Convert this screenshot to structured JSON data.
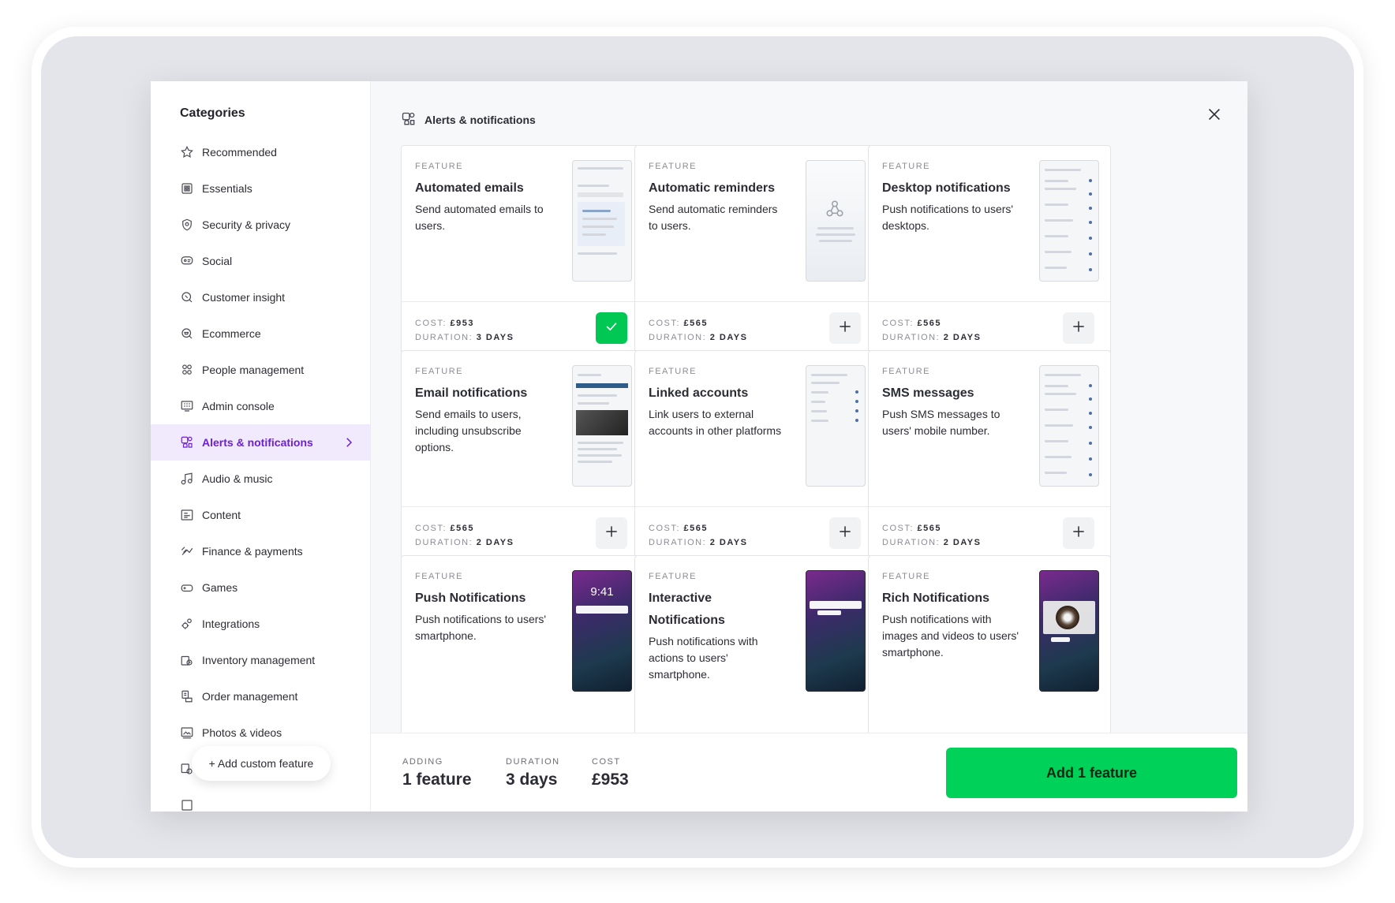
{
  "sidebar": {
    "title": "Categories",
    "items": [
      {
        "label": "Recommended",
        "icon": "star-icon"
      },
      {
        "label": "Essentials",
        "icon": "grid-icon"
      },
      {
        "label": "Security & privacy",
        "icon": "shield-icon"
      },
      {
        "label": "Social",
        "icon": "chat-icon"
      },
      {
        "label": "Customer insight",
        "icon": "insight-icon"
      },
      {
        "label": "Ecommerce",
        "icon": "cart-icon"
      },
      {
        "label": "People management",
        "icon": "people-icon"
      },
      {
        "label": "Admin console",
        "icon": "console-icon"
      },
      {
        "label": "Alerts & notifications",
        "icon": "bell-icon",
        "active": true
      },
      {
        "label": "Audio & music",
        "icon": "music-icon"
      },
      {
        "label": "Content",
        "icon": "content-icon"
      },
      {
        "label": "Finance & payments",
        "icon": "finance-icon"
      },
      {
        "label": "Games",
        "icon": "gamepad-icon"
      },
      {
        "label": "Integrations",
        "icon": "gear-icon"
      },
      {
        "label": "Inventory management",
        "icon": "inventory-icon"
      },
      {
        "label": "Order management",
        "icon": "order-icon"
      },
      {
        "label": "Photos & videos",
        "icon": "photo-icon"
      }
    ],
    "add_custom_label": "+ Add custom feature"
  },
  "header": {
    "breadcrumb": "Alerts & notifications",
    "breadcrumb_icon": "bell-icon",
    "close_icon": "close-icon"
  },
  "cards": [
    {
      "label": "FEATURE",
      "name": "Automated emails",
      "desc": "Send automated emails to users.",
      "cost_label": "COST:",
      "cost": "£953",
      "duration_label": "DURATION:",
      "duration": "3 DAYS",
      "added": true
    },
    {
      "label": "FEATURE",
      "name": "Automatic reminders",
      "desc": "Send automatic reminders to users.",
      "cost_label": "COST:",
      "cost": "£565",
      "duration_label": "DURATION:",
      "duration": "2 DAYS",
      "added": false
    },
    {
      "label": "FEATURE",
      "name": "Desktop notifications",
      "desc": "Push notifications to users' desktops.",
      "cost_label": "COST:",
      "cost": "£565",
      "duration_label": "DURATION:",
      "duration": "2 DAYS",
      "added": false
    },
    {
      "label": "FEATURE",
      "name": "Email notifications",
      "desc": "Send emails to users, including unsubscribe options.",
      "cost_label": "COST:",
      "cost": "£565",
      "duration_label": "DURATION:",
      "duration": "2 DAYS",
      "added": false
    },
    {
      "label": "FEATURE",
      "name": "Linked accounts",
      "desc": "Link users to external accounts in other platforms",
      "cost_label": "COST:",
      "cost": "£565",
      "duration_label": "DURATION:",
      "duration": "2 DAYS",
      "added": false
    },
    {
      "label": "FEATURE",
      "name": "SMS messages",
      "desc": "Push SMS messages to users' mobile number.",
      "cost_label": "COST:",
      "cost": "£565",
      "duration_label": "DURATION:",
      "duration": "2 DAYS",
      "added": false
    },
    {
      "label": "FEATURE",
      "name": "Push Notifications",
      "desc": "Push notifications to users' smartphone.",
      "phone_time": "9:41"
    },
    {
      "label": "FEATURE",
      "name": "Interactive Notifications",
      "desc": "Push notifications with actions to users' smartphone."
    },
    {
      "label": "FEATURE",
      "name": "Rich Notifications",
      "desc": "Push notifications with images and videos to users' smartphone."
    }
  ],
  "footer": {
    "adding_label": "ADDING",
    "adding_value": "1 feature",
    "duration_label": "DURATION",
    "duration_value": "3 days",
    "cost_label": "COST",
    "cost_value": "£953",
    "primary_button": "Add 1 feature"
  },
  "colors": {
    "accent": "#6d1fd6",
    "primary": "#00d159",
    "added": "#00c853"
  }
}
